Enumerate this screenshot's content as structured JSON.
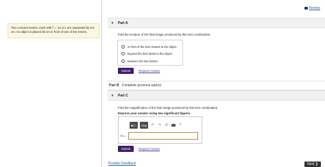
{
  "review_link": "Review",
  "problem_text": "Two concave lenses, each with f = -14 cm, are separated by 8.0 cm. An object is placed 30 cm in front of one of the lenses.",
  "partA": {
    "title": "Part A",
    "question": "Find the location of the final image produced by this lens combination.",
    "options": [
      "in front of the lens closest to the object",
      "beyond the lens farest to the object",
      "between the two lenses"
    ],
    "submit_label": "Submit",
    "request_label": "Request Answer"
  },
  "partB": {
    "label": "Part B",
    "text": "Complete previous part(s)"
  },
  "partC": {
    "title": "Part C",
    "question": "Find the magnification of the final image produced by this lens combination.",
    "instruction": "Express your answer using two significant figures.",
    "toolbar": {
      "templates": "■√□",
      "symbols": "ΑΣφ",
      "undo": "↶",
      "redo": "↷",
      "reset": "↺",
      "help": "?"
    },
    "var_label": "m =",
    "submit_label": "Submit",
    "request_label": "Request Answer"
  },
  "footer": {
    "feedback": "Provide Feedback",
    "next": "Next ❯"
  }
}
